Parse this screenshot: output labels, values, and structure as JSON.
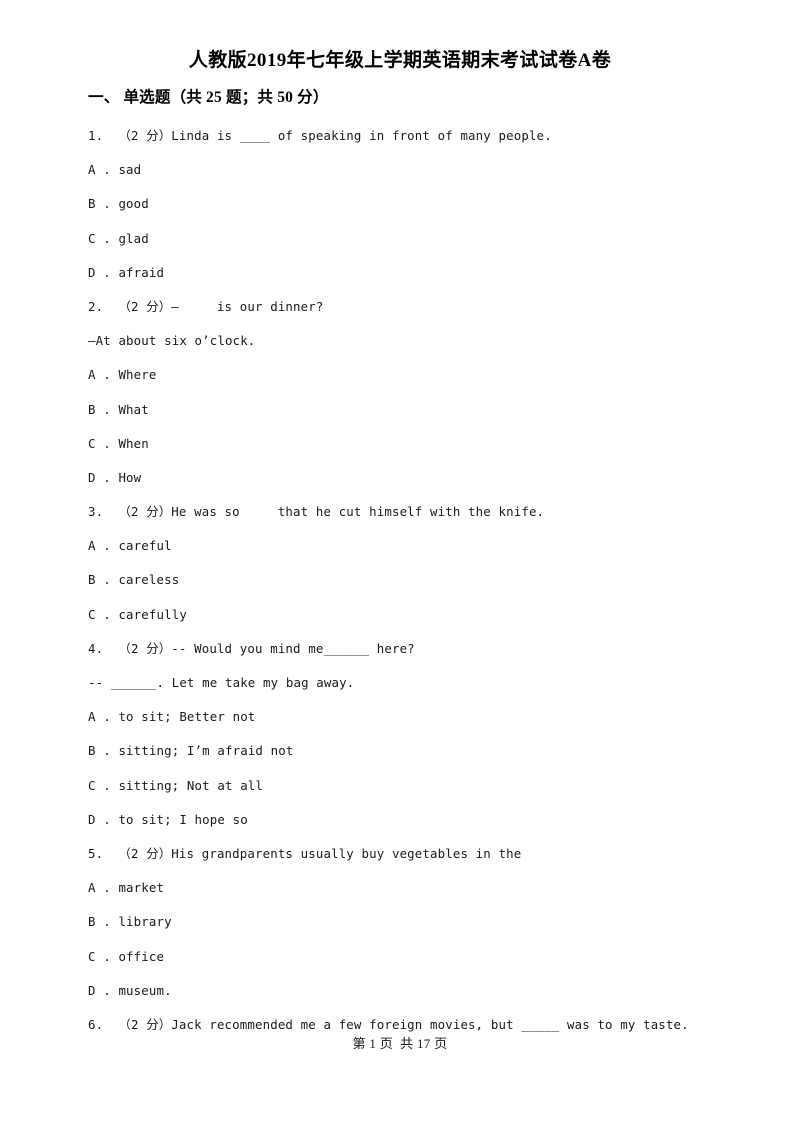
{
  "document": {
    "title": "人教版2019年七年级上学期英语期末考试试卷A卷",
    "background_color": "#ffffff",
    "text_color": "#1a1a1a"
  },
  "section": {
    "heading": "一、 单选题（共 25 题；共 50 分）"
  },
  "lines": [
    {
      "id": "q1-stem",
      "kind": "stem",
      "text": "1.  （2 分）Linda is ____ of speaking in front of many people."
    },
    {
      "id": "q1-optA",
      "kind": "option",
      "text": "A . sad"
    },
    {
      "id": "q1-optB",
      "kind": "option",
      "text": "B . good"
    },
    {
      "id": "q1-optC",
      "kind": "option",
      "text": "C . glad"
    },
    {
      "id": "q1-optD",
      "kind": "option",
      "text": "D . afraid"
    },
    {
      "id": "q2-stem",
      "kind": "stem",
      "text": "2.  （2 分）—     is our dinner?"
    },
    {
      "id": "q2-stem2",
      "kind": "cont",
      "text": "—At about six o’clock."
    },
    {
      "id": "q2-optA",
      "kind": "option",
      "text": "A . Where"
    },
    {
      "id": "q2-optB",
      "kind": "option",
      "text": "B . What"
    },
    {
      "id": "q2-optC",
      "kind": "option",
      "text": "C . When"
    },
    {
      "id": "q2-optD",
      "kind": "option",
      "text": "D . How"
    },
    {
      "id": "q3-stem",
      "kind": "stem",
      "text": "3.  （2 分）He was so     that he cut himself with the knife."
    },
    {
      "id": "q3-optA",
      "kind": "option",
      "text": "A . careful"
    },
    {
      "id": "q3-optB",
      "kind": "option",
      "text": "B . careless"
    },
    {
      "id": "q3-optC",
      "kind": "option",
      "text": "C . carefully"
    },
    {
      "id": "q4-stem",
      "kind": "stem",
      "text": "4.  （2 分）-- Would you mind me______ here?"
    },
    {
      "id": "q4-stem2",
      "kind": "cont",
      "text": "-- ______. Let me take my bag away."
    },
    {
      "id": "q4-optA",
      "kind": "option",
      "text": "A . to sit; Better not"
    },
    {
      "id": "q4-optB",
      "kind": "option",
      "text": "B . sitting; I’m afraid not"
    },
    {
      "id": "q4-optC",
      "kind": "option",
      "text": "C . sitting; Not at all"
    },
    {
      "id": "q4-optD",
      "kind": "option",
      "text": "D . to sit; I hope so"
    },
    {
      "id": "q5-stem",
      "kind": "stem",
      "text": "5.  （2 分）His grandparents usually buy vegetables in the"
    },
    {
      "id": "q5-optA",
      "kind": "option",
      "text": "A . market"
    },
    {
      "id": "q5-optB",
      "kind": "option",
      "text": "B . library"
    },
    {
      "id": "q5-optC",
      "kind": "option",
      "text": "C . office"
    },
    {
      "id": "q5-optD",
      "kind": "option",
      "text": "D . museum."
    },
    {
      "id": "q6-stem",
      "kind": "stem",
      "text": "6.  （2 分）Jack recommended me a few foreign movies, but _____ was to my taste."
    }
  ],
  "footer": {
    "text": "第 1 页  共 17 页",
    "current_page": "1",
    "total_pages": "17"
  }
}
